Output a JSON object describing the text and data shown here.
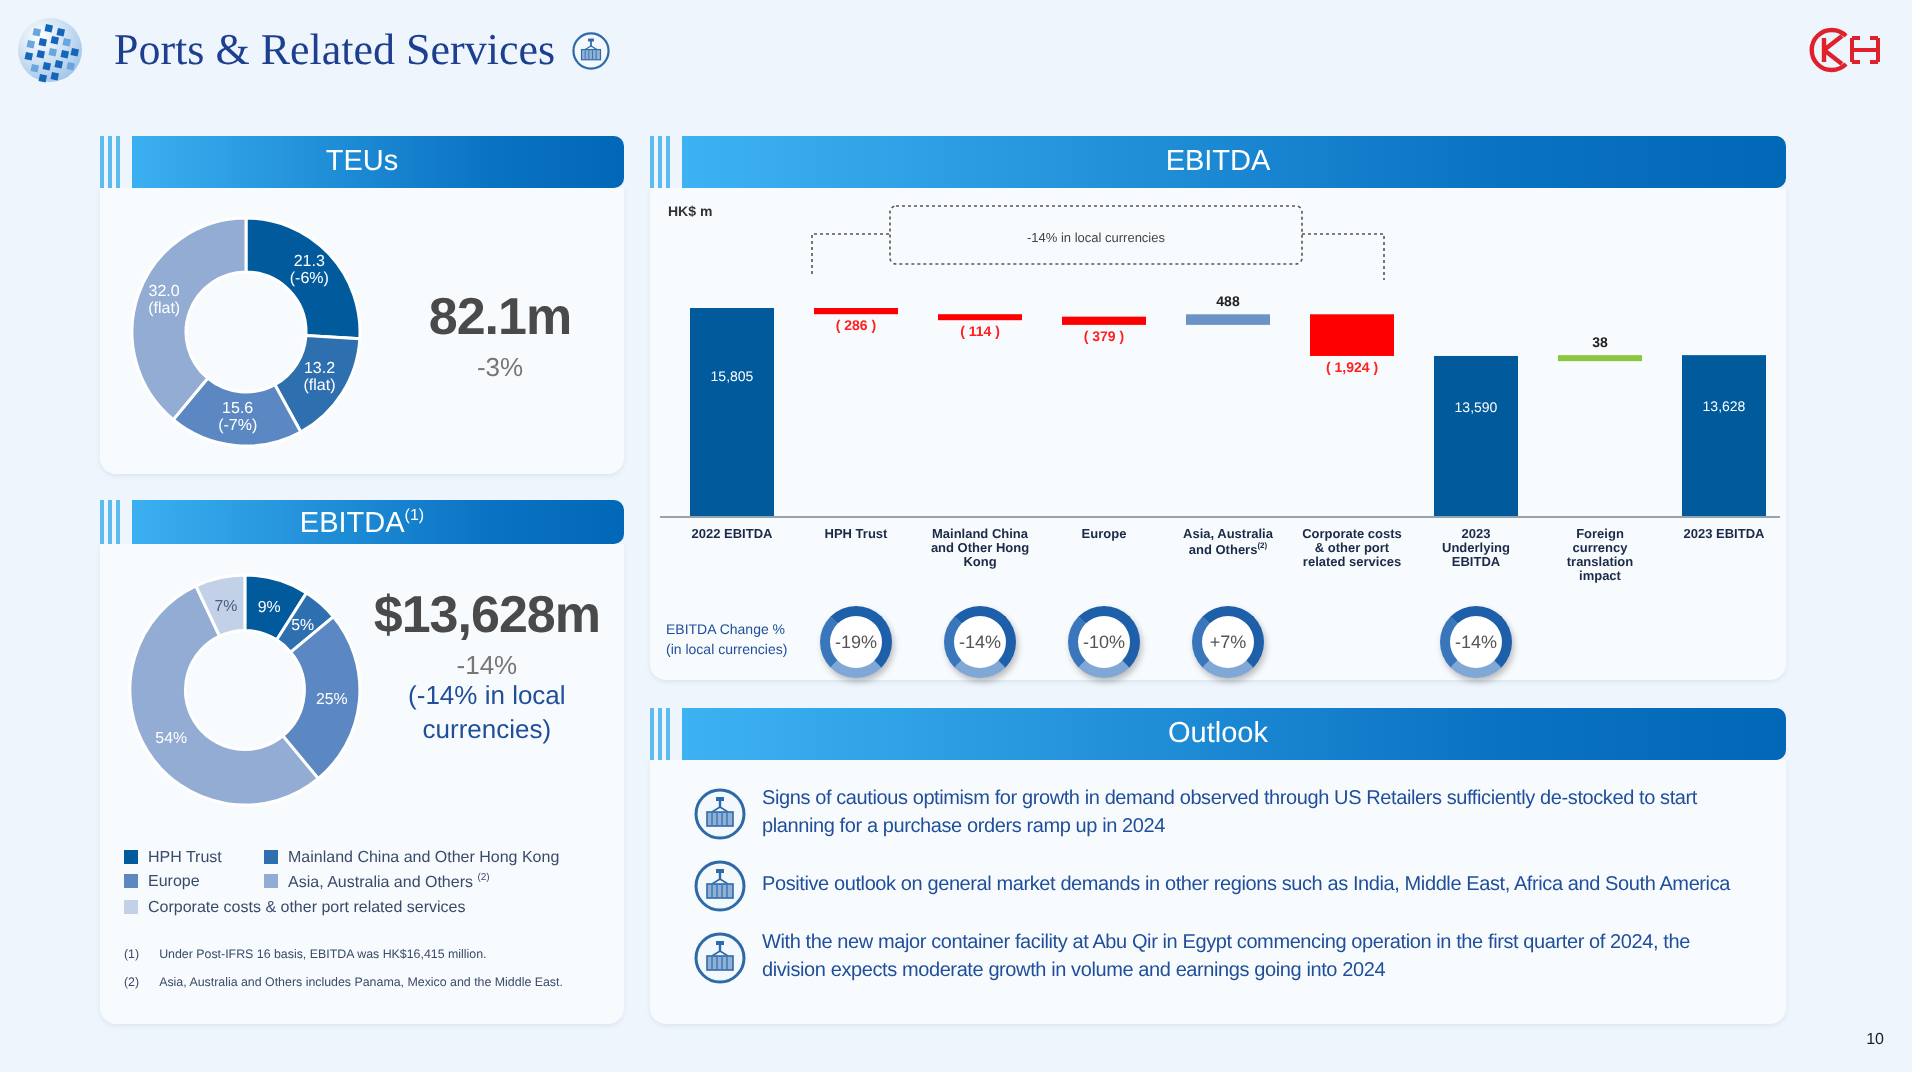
{
  "title": "Ports & Related Services",
  "page_number": "10",
  "teus": {
    "header": "TEUs",
    "total": "82.1m",
    "change": "-3%",
    "chart_data": {
      "type": "donut",
      "values": [
        21.3,
        13.2,
        15.6,
        32.0
      ],
      "value_labels": [
        "21.3 (-6%)",
        "13.2 (flat)",
        "15.6 (-7%)",
        "32.0 (flat)"
      ]
    }
  },
  "ebitda_mix": {
    "header": "EBITDA$^{(1)}$",
    "total": "$13,628m",
    "change": "-14%",
    "change_local": "(-14% in local currencies)",
    "chart_data": {
      "type": "donut",
      "categories": [
        "HPH Trust",
        "Mainland China and Other Hong Kong",
        "Europe",
        "Asia, Australia and Others $^{(2)}$",
        "Corporate costs & other port related services"
      ],
      "values": [
        9,
        5,
        25,
        54,
        7
      ],
      "value_labels": [
        "9%",
        "5%",
        "25%",
        "54%",
        "7%"
      ]
    },
    "footnotes": [
      {
        "mark": "(1)",
        "text": "Under Post-IFRS 16 basis, EBITDA was HK$16,415 million."
      },
      {
        "mark": "(2)",
        "text": "Asia, Australia and Others includes Panama, Mexico and the Middle East."
      }
    ]
  },
  "ebitda_bridge": {
    "header": "EBITDA",
    "unit": "HK$ m",
    "annotation": "-14% in local currencies",
    "bars": [
      {
        "kind": "total",
        "label": "2022 EBITDA",
        "value": "15,805"
      },
      {
        "kind": "decrease",
        "label": "HPH Trust",
        "value": "( 286 )",
        "change": "-19%"
      },
      {
        "kind": "decrease",
        "label": "Mainland China and Other Hong Kong",
        "value": "( 114 )",
        "change": "-14%"
      },
      {
        "kind": "decrease",
        "label": "Europe",
        "value": "( 379 )",
        "change": "-10%"
      },
      {
        "kind": "increase",
        "label": "Asia, Australia and Others$^{(2)}$",
        "value": "488",
        "change": "+7%"
      },
      {
        "kind": "decrease",
        "label": "Corporate costs & other port related services",
        "value": "( 1,924 )"
      },
      {
        "kind": "total",
        "label": "2023 Underlying EBITDA",
        "value": "13,590",
        "change": "-14%"
      },
      {
        "kind": "currency",
        "label": "Foreign currency translation impact",
        "value": "38"
      },
      {
        "kind": "total",
        "label": "2023 EBITDA",
        "value": "13,628"
      }
    ],
    "change_label": "EBITDA Change %\n(in local currencies)"
  },
  "outlook": {
    "header": "Outlook",
    "items": [
      "Signs of cautious optimism for growth in demand observed through US Retailers sufficiently de-stocked to start planning for a purchase orders ramp up in 2024",
      "Positive outlook on general market demands in other regions such as India, Middle East, Africa and South America",
      "With the new major container facility at Abu Qir in Egypt commencing operation in the first quarter of 2024, the division expects moderate growth in volume and earnings going into 2024"
    ]
  }
}
